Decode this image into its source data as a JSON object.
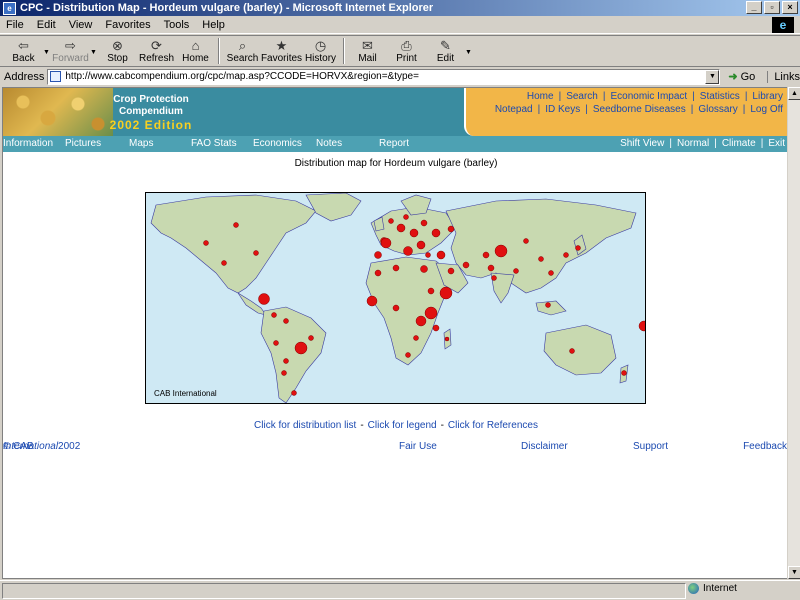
{
  "window": {
    "title": "CPC - Distribution Map - Hordeum vulgare (barley) - Microsoft Internet Explorer",
    "controls": [
      "_",
      "▫",
      "×"
    ]
  },
  "menu": [
    "File",
    "Edit",
    "View",
    "Favorites",
    "Tools",
    "Help"
  ],
  "toolbar": [
    {
      "label": "Back",
      "icon": "back-arrow-icon",
      "glyph": "⇦",
      "disabled": false
    },
    {
      "label": "Forward",
      "icon": "forward-arrow-icon",
      "glyph": "⇨",
      "disabled": true
    },
    {
      "label": "Stop",
      "icon": "stop-icon",
      "glyph": "⊗",
      "disabled": false
    },
    {
      "label": "Refresh",
      "icon": "refresh-icon",
      "glyph": "⟳",
      "disabled": false
    },
    {
      "label": "Home",
      "icon": "home-icon",
      "glyph": "⌂",
      "disabled": false
    },
    {
      "label": "Search",
      "icon": "search-icon",
      "glyph": "⌕",
      "disabled": false
    },
    {
      "label": "Favorites",
      "icon": "favorites-icon",
      "glyph": "★",
      "disabled": false
    },
    {
      "label": "History",
      "icon": "history-icon",
      "glyph": "◷",
      "disabled": false
    },
    {
      "label": "Mail",
      "icon": "mail-icon",
      "glyph": "✉",
      "disabled": false
    },
    {
      "label": "Print",
      "icon": "print-icon",
      "glyph": "⎙",
      "disabled": false
    },
    {
      "label": "Edit",
      "icon": "edit-icon",
      "glyph": "✎",
      "disabled": false
    }
  ],
  "address": {
    "label": "Address",
    "url": "http://www.cabcompendium.org/cpc/map.asp?CCODE=HORVX&region=&type=",
    "go_label": "Go",
    "links_label": "Links"
  },
  "banner": {
    "brand_line1": "Crop Protection",
    "brand_line2": "Compendium",
    "edition": "2002 Edition",
    "nav_row1": [
      "Home",
      "Search",
      "Economic Impact",
      "Statistics",
      "Library"
    ],
    "nav_row2": [
      "Notepad",
      "ID Keys",
      "Seedborne Diseases",
      "Glossary",
      "Log Off"
    ]
  },
  "menustrip": {
    "left": [
      "Information",
      "Pictures",
      "Maps",
      "FAO Stats",
      "Economics",
      "Notes",
      "Report"
    ],
    "right": [
      "Shift View",
      "Normal",
      "Climate",
      "Exit"
    ]
  },
  "page": {
    "map_title": "Distribution map for Hordeum vulgare (barley)",
    "map_credit": "CAB International",
    "links": [
      "Click for distribution list",
      "Click for legend",
      "Click for References"
    ],
    "link_separator": "-"
  },
  "footer": {
    "copyright_prefix": "© CAB ",
    "copyright_italic": "International",
    "copyright_year": " 2002",
    "fair_use": "Fair Use",
    "disclaimer": "Disclaimer",
    "support": "Support",
    "feedback": "Feedback"
  },
  "status": {
    "zone": "Internet"
  },
  "colors": {
    "banner_teal": "#3a8ca0",
    "menu_strip": "#4da1b3",
    "nav_orange": "#f2b648",
    "link_blue": "#1c4ab0",
    "land": "#c8d9b0",
    "ocean": "#cfe9f4",
    "marker_red": "#e01010"
  }
}
